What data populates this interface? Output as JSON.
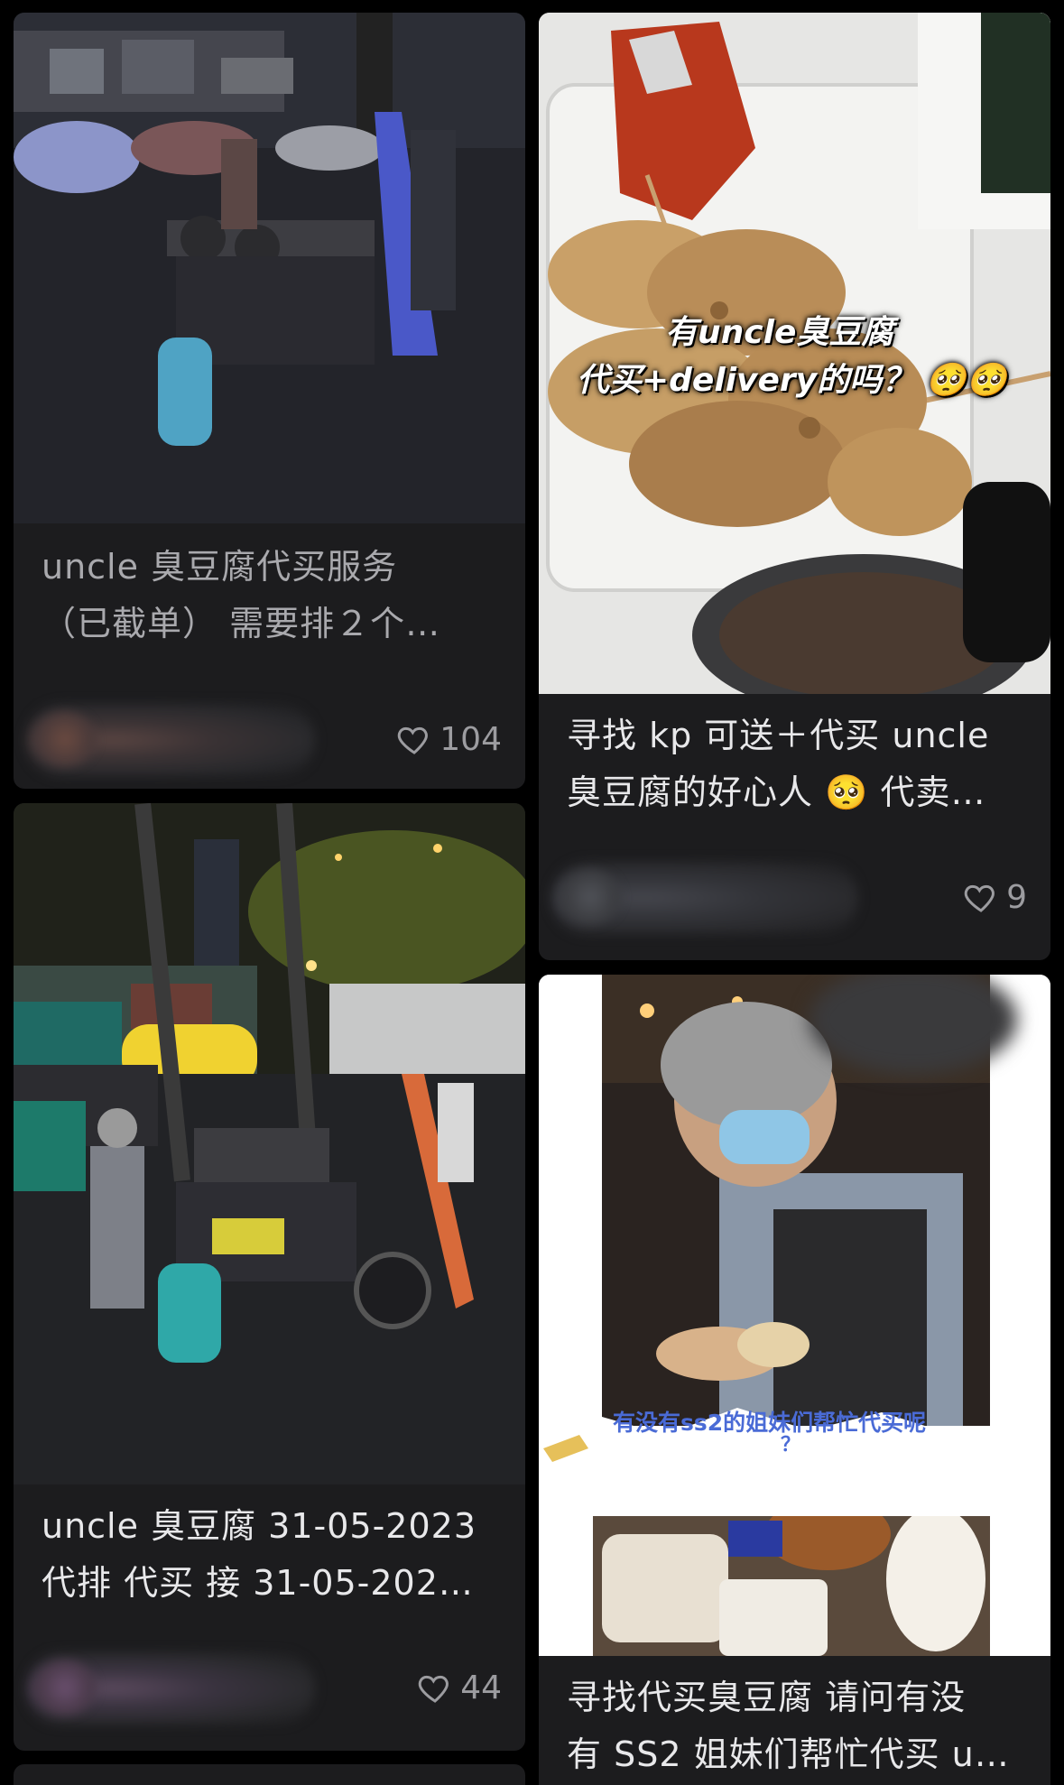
{
  "feed": {
    "left": [
      {
        "title_lines": [
          "uncle 臭豆腐代买服务",
          "（已截单） 需要排２个…"
        ],
        "likes": "104",
        "image_desc_icon": "photo-night-street-stall"
      },
      {
        "title_lines": [
          "uncle 臭豆腐 31-05-2023",
          "代排 代买 接 31-05-202…"
        ],
        "likes": "44",
        "image_desc_icon": "photo-night-stall-vendor"
      }
    ],
    "right": [
      {
        "title_lines": [
          "寻找 kp 可送＋代买 uncle",
          "臭豆腐的好心人 🥺 代卖…"
        ],
        "likes": "9",
        "overlay_lines": [
          "有uncle臭豆腐",
          "代买+delivery的吗？ 🥺🥺"
        ],
        "image_desc_icon": "photo-fried-tofu-box"
      },
      {
        "title_lines": [
          "寻找代买臭豆腐 请问有没",
          "有 SS2 姐妹们帮忙代买 u…"
        ],
        "overlay_lines": [
          "有没有ss2的姐妹们帮忙代买呢",
          "？"
        ],
        "image_desc_icon": "photo-vendor-masked"
      }
    ]
  },
  "colors": {
    "background": "#000000",
    "card": "#1c1c1e",
    "title": "#e8e8ea",
    "meta": "#9c9ca0",
    "overlay_blue": "#4a6bd6"
  }
}
